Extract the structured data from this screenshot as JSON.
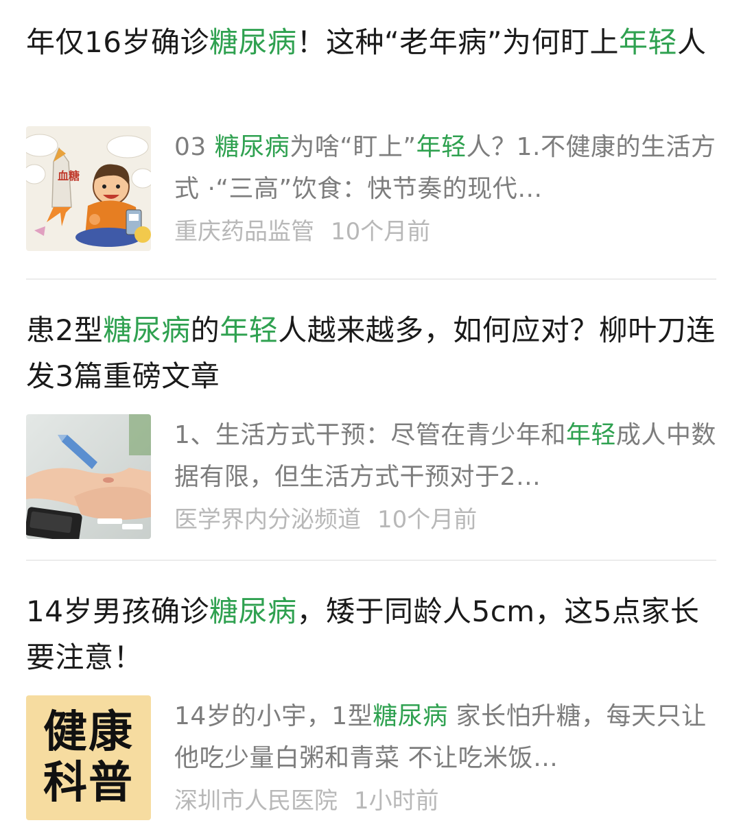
{
  "colors": {
    "highlight": "#2fa150",
    "title": "#1a1a1a",
    "snippet": "#7d7d7d",
    "meta": "#b8b8b8",
    "divider": "#ececec"
  },
  "results": [
    {
      "title_parts": [
        {
          "text": "年仅16岁确诊",
          "hl": false
        },
        {
          "text": "糖尿病",
          "hl": true
        },
        {
          "text": "！这种“老年病”为何盯上",
          "hl": false
        },
        {
          "text": "年轻",
          "hl": true
        },
        {
          "text": "人",
          "hl": false
        }
      ],
      "snippet_parts": [
        {
          "text": "03 ",
          "hl": false
        },
        {
          "text": "糖尿病",
          "hl": true
        },
        {
          "text": "为啥“盯上”",
          "hl": false
        },
        {
          "text": "年轻",
          "hl": true
        },
        {
          "text": "人？1.不健康的生活方式 ·“三高”饮食：快节奏的现代…",
          "hl": false
        }
      ],
      "thumbnail": {
        "icon": "cartoon-blood-sugar-illustration-icon",
        "text": "血糖"
      },
      "source": "重庆药品监管",
      "time": "10个月前"
    },
    {
      "title_parts": [
        {
          "text": "患2型",
          "hl": false
        },
        {
          "text": "糖尿病",
          "hl": true
        },
        {
          "text": "的",
          "hl": false
        },
        {
          "text": "年轻",
          "hl": true
        },
        {
          "text": "人越来越多，如何应对？柳叶刀连发3篇重磅文章",
          "hl": false
        }
      ],
      "snippet_parts": [
        {
          "text": "1、生活方式干预：尽管在青少年和",
          "hl": false
        },
        {
          "text": "年轻",
          "hl": true
        },
        {
          "text": "成人中数据有限，但生活方式干预对于2…",
          "hl": false
        }
      ],
      "thumbnail": {
        "icon": "glucose-test-photo-icon"
      },
      "source": "医学界内分泌频道",
      "time": "10个月前"
    },
    {
      "title_parts": [
        {
          "text": "14岁男孩确诊",
          "hl": false
        },
        {
          "text": "糖尿病",
          "hl": true
        },
        {
          "text": "，矮于同龄人5cm，这5点家长要注意！",
          "hl": false
        }
      ],
      "snippet_parts": [
        {
          "text": "14岁的小宇，1型",
          "hl": false
        },
        {
          "text": "糖尿病",
          "hl": true
        },
        {
          "text": " 家长怕升糖，每天只让他吃少量白粥和青菜 不让吃米饭…",
          "hl": false
        }
      ],
      "thumbnail": {
        "icon": "health-science-badge-icon",
        "line1": "健康",
        "line2": "科普"
      },
      "source": "深圳市人民医院",
      "time": "1小时前"
    }
  ]
}
